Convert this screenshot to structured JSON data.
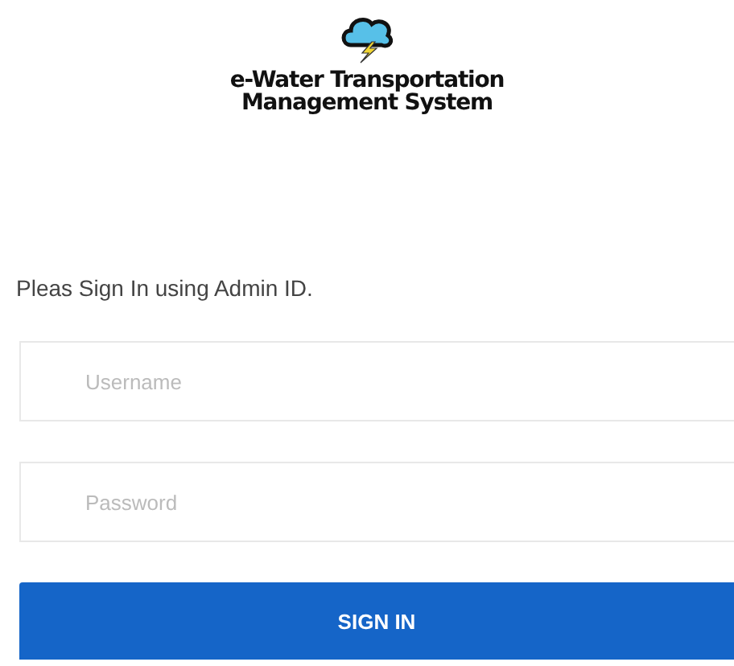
{
  "header": {
    "title_lines": [
      "e-Water Transportation",
      "Management System"
    ]
  },
  "form": {
    "instruction": "Pleas Sign In using Admin ID.",
    "fields": [
      {
        "placeholder": "Username"
      },
      {
        "placeholder": "Password"
      }
    ],
    "submit": "SIGN IN"
  }
}
